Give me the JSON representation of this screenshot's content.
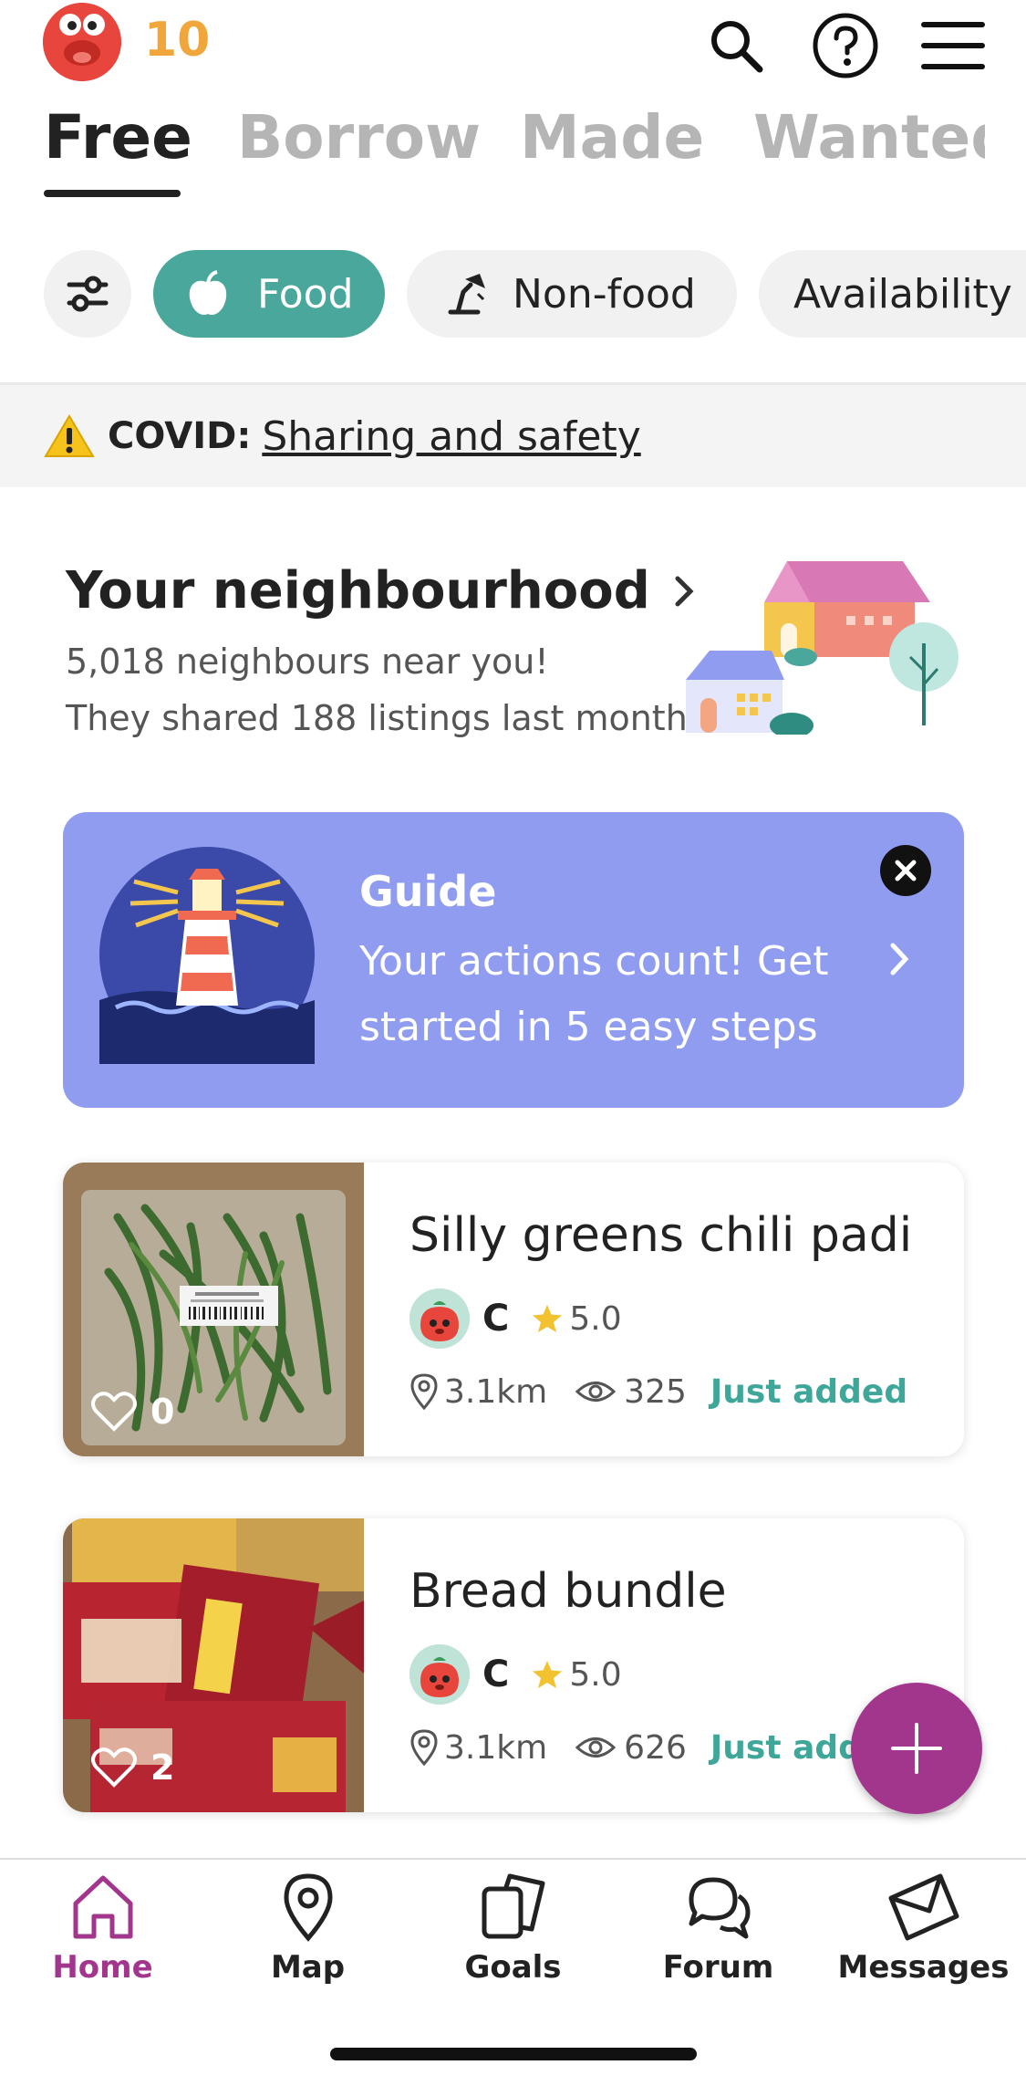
{
  "header": {
    "karma": "10",
    "icons": [
      "search-icon",
      "help-icon",
      "menu-icon"
    ]
  },
  "tabs": [
    {
      "label": "Free",
      "active": true
    },
    {
      "label": "Borrow",
      "active": false
    },
    {
      "label": "Made",
      "active": false
    },
    {
      "label": "Wanted",
      "active": false
    }
  ],
  "chips": [
    {
      "label": "Food",
      "icon": "apple-icon",
      "active": true
    },
    {
      "label": "Non-food",
      "icon": "lamp-icon",
      "active": false
    },
    {
      "label": "Availability",
      "active": false
    }
  ],
  "covid": {
    "label": "COVID:",
    "link": "Sharing and safety"
  },
  "neighbourhood": {
    "title": "Your neighbourhood",
    "neighbours": "5,018 neighbours near you!",
    "listings": "They shared 188 listings last month"
  },
  "guide": {
    "title": "Guide",
    "text": "Your actions count! Get started in 5 easy steps"
  },
  "listings": [
    {
      "title": "Silly greens chili padi",
      "user": "C",
      "rating": "5.0",
      "distance": "3.1km",
      "views": "325",
      "status": "Just added",
      "likes": "0"
    },
    {
      "title": "Bread bundle",
      "user": "C",
      "rating": "5.0",
      "distance": "3.1km",
      "views": "626",
      "status": "Just added",
      "likes": "2"
    }
  ],
  "nav": [
    {
      "label": "Home",
      "icon": "home-icon",
      "active": true
    },
    {
      "label": "Map",
      "icon": "map-pin-icon",
      "active": false
    },
    {
      "label": "Goals",
      "icon": "goals-icon",
      "active": false
    },
    {
      "label": "Forum",
      "icon": "forum-icon",
      "active": false
    },
    {
      "label": "Messages",
      "icon": "messages-icon",
      "active": false
    }
  ],
  "colors": {
    "accent_teal": "#4aa79b",
    "brand_purple": "#a2368d",
    "guide_bg": "#8f9cf0",
    "karma_orange": "#f0a63a"
  }
}
